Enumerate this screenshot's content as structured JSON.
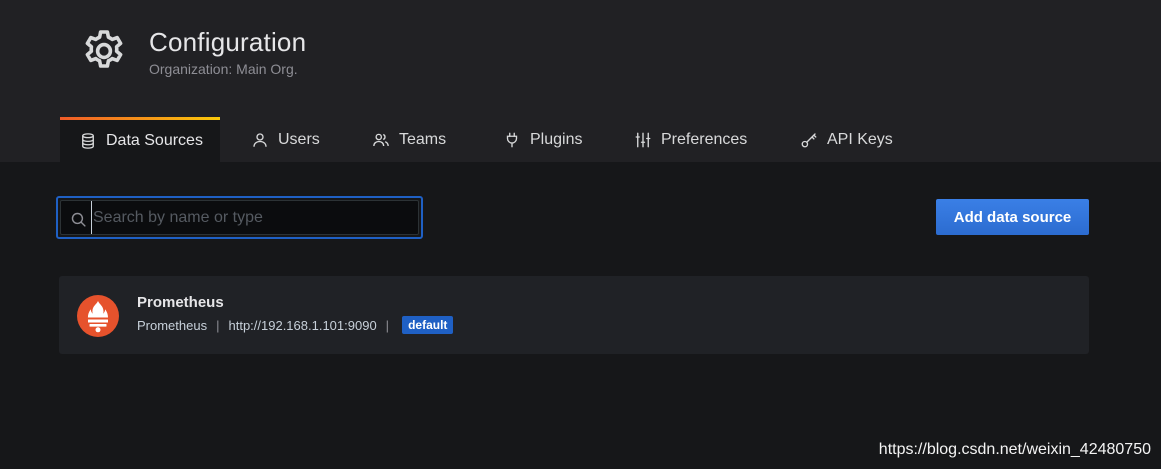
{
  "header": {
    "title": "Configuration",
    "subtitle": "Organization: Main Org."
  },
  "tabs": [
    {
      "label": "Data Sources",
      "icon": "database-icon",
      "active": true
    },
    {
      "label": "Users",
      "icon": "user-icon",
      "active": false
    },
    {
      "label": "Teams",
      "icon": "users-icon",
      "active": false
    },
    {
      "label": "Plugins",
      "icon": "plug-icon",
      "active": false
    },
    {
      "label": "Preferences",
      "icon": "sliders-icon",
      "active": false
    },
    {
      "label": "API Keys",
      "icon": "key-icon",
      "active": false
    }
  ],
  "search": {
    "placeholder": "Search by name or type",
    "value": ""
  },
  "actions": {
    "add_label": "Add data source"
  },
  "datasources": [
    {
      "name": "Prometheus",
      "type": "Prometheus",
      "url": "http://192.168.1.101:9090",
      "badge": "default",
      "logo": "prometheus-logo"
    }
  ],
  "watermark": "https://blog.csdn.net/weixin_42480750",
  "colors": {
    "accent": "#3274d9",
    "focus": "#1f60c4",
    "tab_gradient_start": "#f05a28",
    "tab_gradient_end": "#fbca0a",
    "prometheus": "#e6522c"
  }
}
